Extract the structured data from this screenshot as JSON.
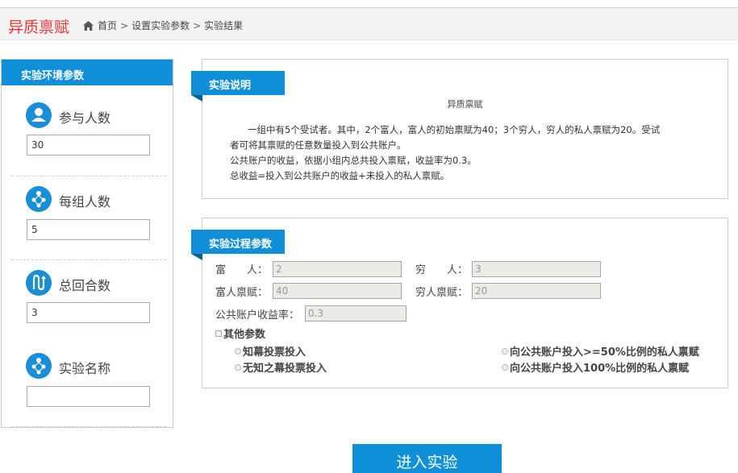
{
  "header": {
    "brand": "异质禀赋",
    "breadcrumb": [
      "首页",
      "设置实验参数",
      "实验结果"
    ],
    "separator": ">"
  },
  "left": {
    "title": "实验环境参数",
    "params": [
      {
        "label": "参与人数",
        "value": "30",
        "icon": "user-icon"
      },
      {
        "label": "每组人数",
        "value": "5",
        "icon": "group-icon"
      },
      {
        "label": "总回合数",
        "value": "3",
        "icon": "rounds-icon"
      },
      {
        "label": "实验名称",
        "value": "",
        "icon": "group-icon"
      }
    ]
  },
  "intro": {
    "tag": "实验说明",
    "title": "异质禀赋",
    "lines": [
      "一组中有5个受试者。其中，2个富人，富人的初始禀赋为40；3个穷人，穷人的私人禀赋为20。受试",
      "者可将其禀赋的任意数量投入到公共账户。",
      "公共账户的收益，依据小组内总共投入禀赋，收益率为0.3。",
      "总收益=投入到公共账户的收益+未投入的私人禀赋。"
    ]
  },
  "process": {
    "tag": "实验过程参数",
    "rich_label": "富　　人：",
    "rich_value": "2",
    "poor_label": "穷　　人：",
    "poor_value": "3",
    "rich_endow_label": "富人禀赋：",
    "rich_endow_value": "40",
    "poor_endow_label": "穷人禀赋：",
    "poor_endow_value": "20",
    "rate_label": "公共账户收益率：",
    "rate_value": "0.3",
    "other_label": "其他参数",
    "options": [
      "知幕投票投入",
      "无知之幕投票投入",
      "向公共账户投入>=50%比例的私人禀赋",
      "向公共账户投入100%比例的私人禀赋"
    ]
  },
  "actions": {
    "enter": "进入实验"
  },
  "colors": {
    "brand": "#e4393c",
    "accent": "#0e8fd8"
  }
}
